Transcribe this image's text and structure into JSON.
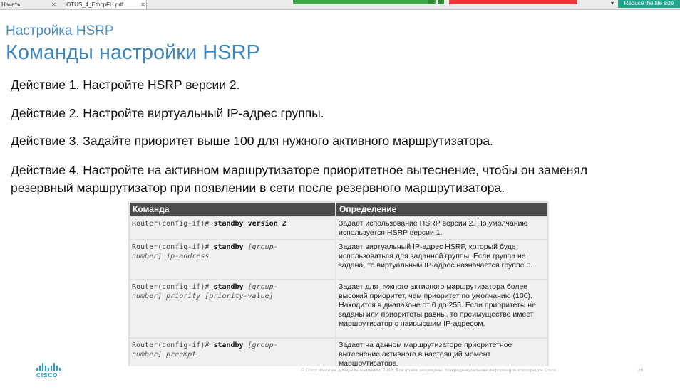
{
  "browser": {
    "tab_start": "Начать",
    "tab_doc": "OTUS_4_EthcpFH.pdf",
    "reduce_button": "Reduce the file size"
  },
  "slide": {
    "subtitle": "Настройка HSRP",
    "title": "Команды настройки HSRP",
    "steps": [
      "Действие 1. Настройте HSRP версии 2.",
      "Действие 2. Настройте виртуальный IP-адрес группы.",
      "Действие 3. Задайте приоритет выше 100 для нужного активного маршрутизатора.",
      "Действие 4. Настройте на активном маршрутизаторе приоритетное вытеснение, чтобы он заменял",
      "резервный маршрутизатор при появлении в сети после резервного маршрутизатора."
    ],
    "table": {
      "headers": [
        "Команда",
        "Определение"
      ],
      "rows": [
        {
          "prompt": "Router(config-if)#",
          "cmd": "standby version 2",
          "args1": "",
          "args2": "",
          "desc": "Задает использование HSRP версии 2. По умолчанию используется HSRP версии 1."
        },
        {
          "prompt": "Router(config-if)#",
          "cmd": "standby",
          "args1": "[group-",
          "args2": "number] ip-address",
          "desc": "Задает виртуальный IP-адрес HSRP, который будет использоваться для заданной группы. Если группа не задана, то виртуальный IP-адрес назначается группе 0."
        },
        {
          "prompt": "Router(config-if)#",
          "cmd": "standby",
          "args1": "[group-",
          "args2": "number] priority [priority-value]",
          "desc": "Задает для нужного активного маршрутизатора более высокий приоритет, чем приоритет по умолчанию (100). Находится в диапазоне от 0 до 255. Если приоритеты не заданы или приоритеты равны, то преимущество имеет маршрутизатор с наивысшим IP-адресом."
        },
        {
          "prompt": "Router(config-if)#",
          "cmd": "standby",
          "args1": "[group-",
          "args2": "number] preempt",
          "desc": "Задает на данном маршрутизаторе приоритетное вытеснение активного в настоящий момент маршрутизатора."
        }
      ]
    },
    "logo_text": "CISCO",
    "footer": "© Cisco и/или ее дочерние компании, 2016. Все права защищены. Конфиденциальная информация корпорации Cisco",
    "page_number": "36"
  },
  "colors": {
    "title": "#3f86bf",
    "header_bg": "#4c4c4c",
    "cell_bg": "#f1f1f1",
    "cisco_blue": "#1ba0d7",
    "reduce_button": "#21a58c"
  }
}
